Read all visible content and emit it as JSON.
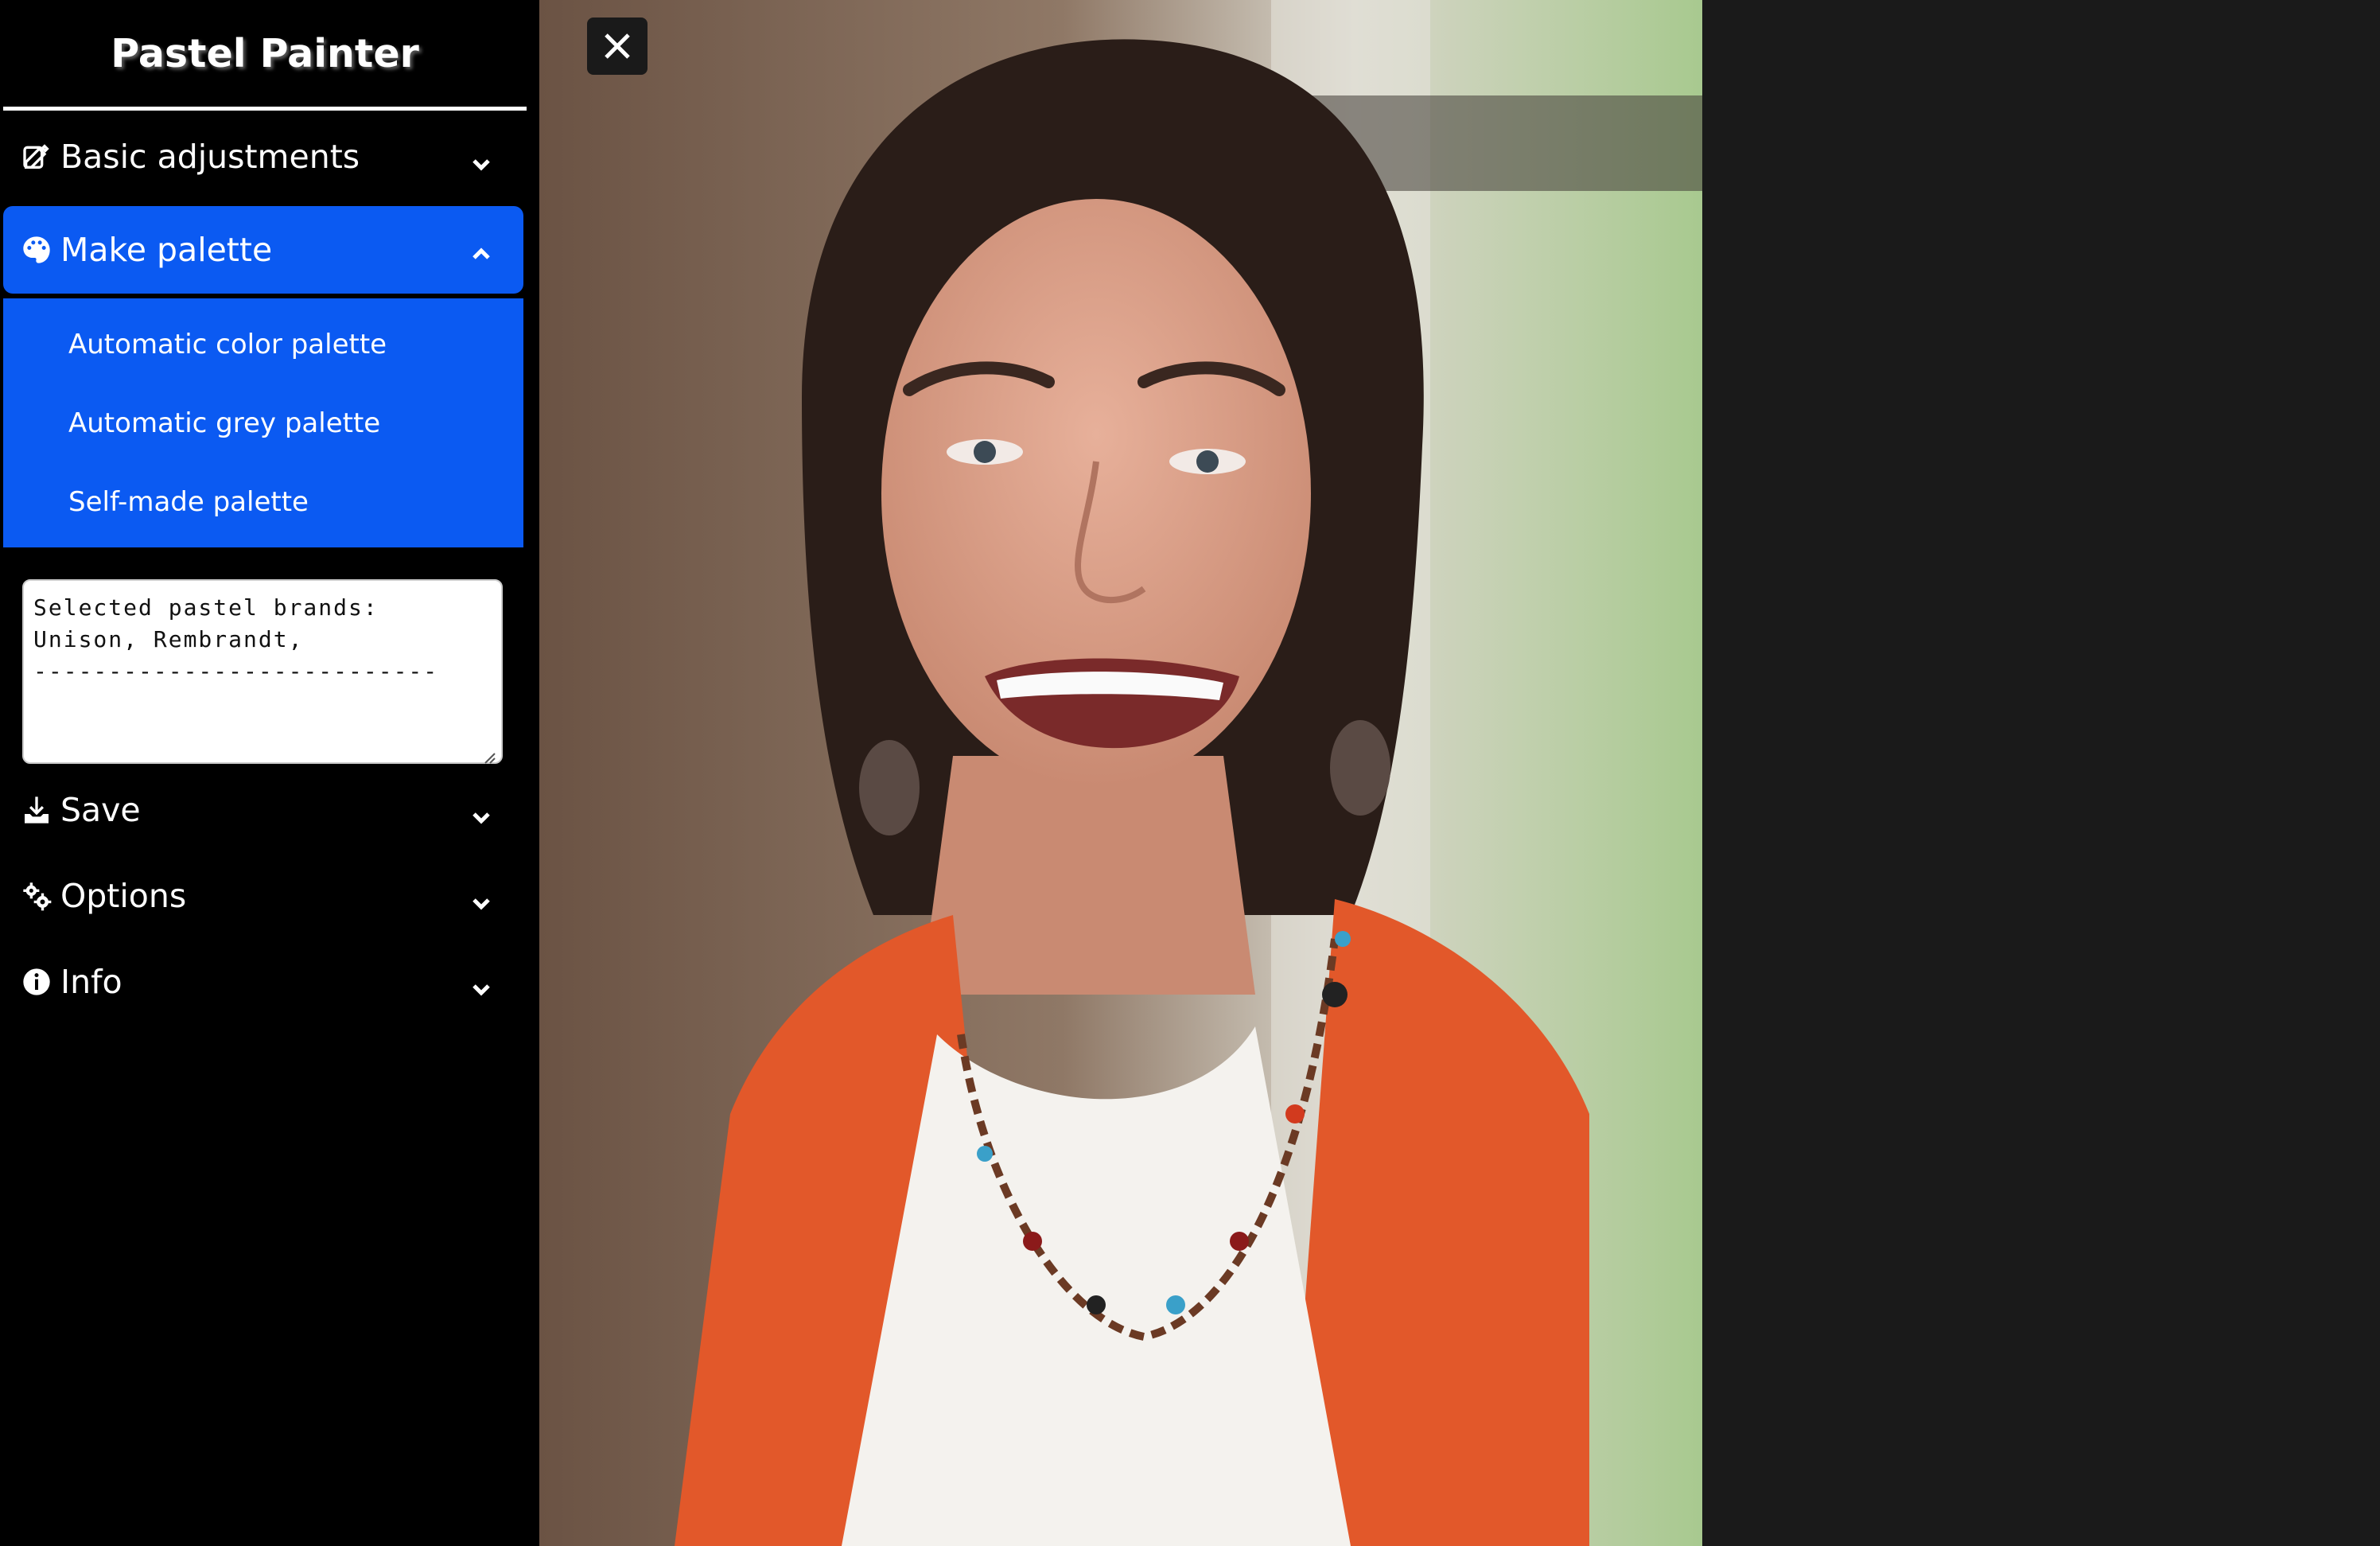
{
  "app": {
    "title": "Pastel Painter"
  },
  "menu": {
    "basic": {
      "label": "Basic adjustments",
      "icon": "edit-icon"
    },
    "palette": {
      "label": "Make palette",
      "icon": "palette-icon",
      "items": [
        {
          "label": "Automatic color palette"
        },
        {
          "label": "Automatic grey palette"
        },
        {
          "label": "Self-made palette"
        }
      ]
    },
    "save": {
      "label": "Save",
      "icon": "download-icon"
    },
    "options": {
      "label": "Options",
      "icon": "gears-icon"
    },
    "info": {
      "label": "Info",
      "icon": "info-icon"
    }
  },
  "brands_box": {
    "text": "Selected pastel brands:\nUnison, Rembrandt,\n---------------------------"
  },
  "colors": {
    "accent": "#0b5af2",
    "sidebar": "#000000",
    "background": "#1a1a1a"
  }
}
